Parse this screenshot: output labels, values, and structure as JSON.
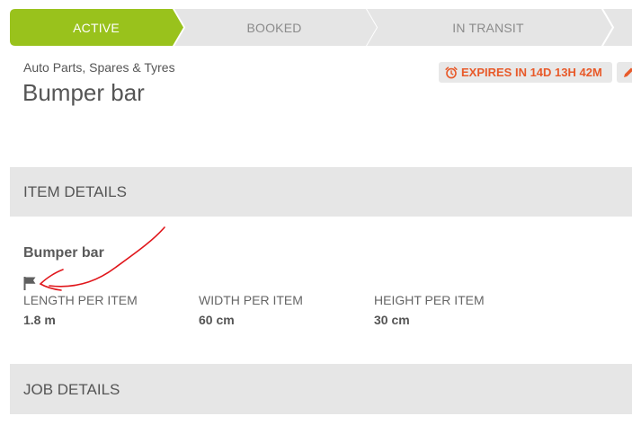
{
  "steps": [
    {
      "label": "ACTIVE",
      "state": "active"
    },
    {
      "label": "BOOKED",
      "state": "inactive"
    },
    {
      "label": "IN TRANSIT",
      "state": "inactive"
    }
  ],
  "colors": {
    "active_step": "#99c21c",
    "inactive_step": "#e5e5e5",
    "expiry_text": "#e85a2a",
    "section_bar": "#e6e6e6",
    "annotation": "#e0161b"
  },
  "listing": {
    "category": "Auto Parts, Spares & Tyres",
    "title": "Bumper bar",
    "expires_label": "EXPIRES IN 14D 13H 42M",
    "expires_icon": "alarm-clock-icon",
    "edit_icon": "pencil-icon"
  },
  "item_details": {
    "section_title": "ITEM DETAILS",
    "item_name": "Bumper bar",
    "flag_icon": "flag-icon",
    "dimensions": [
      {
        "label": "LENGTH PER ITEM",
        "value": "1.8 m"
      },
      {
        "label": "WIDTH PER ITEM",
        "value": "60 cm"
      },
      {
        "label": "HEIGHT PER ITEM",
        "value": "30 cm"
      }
    ]
  },
  "job_details": {
    "section_title": "JOB DETAILS"
  }
}
